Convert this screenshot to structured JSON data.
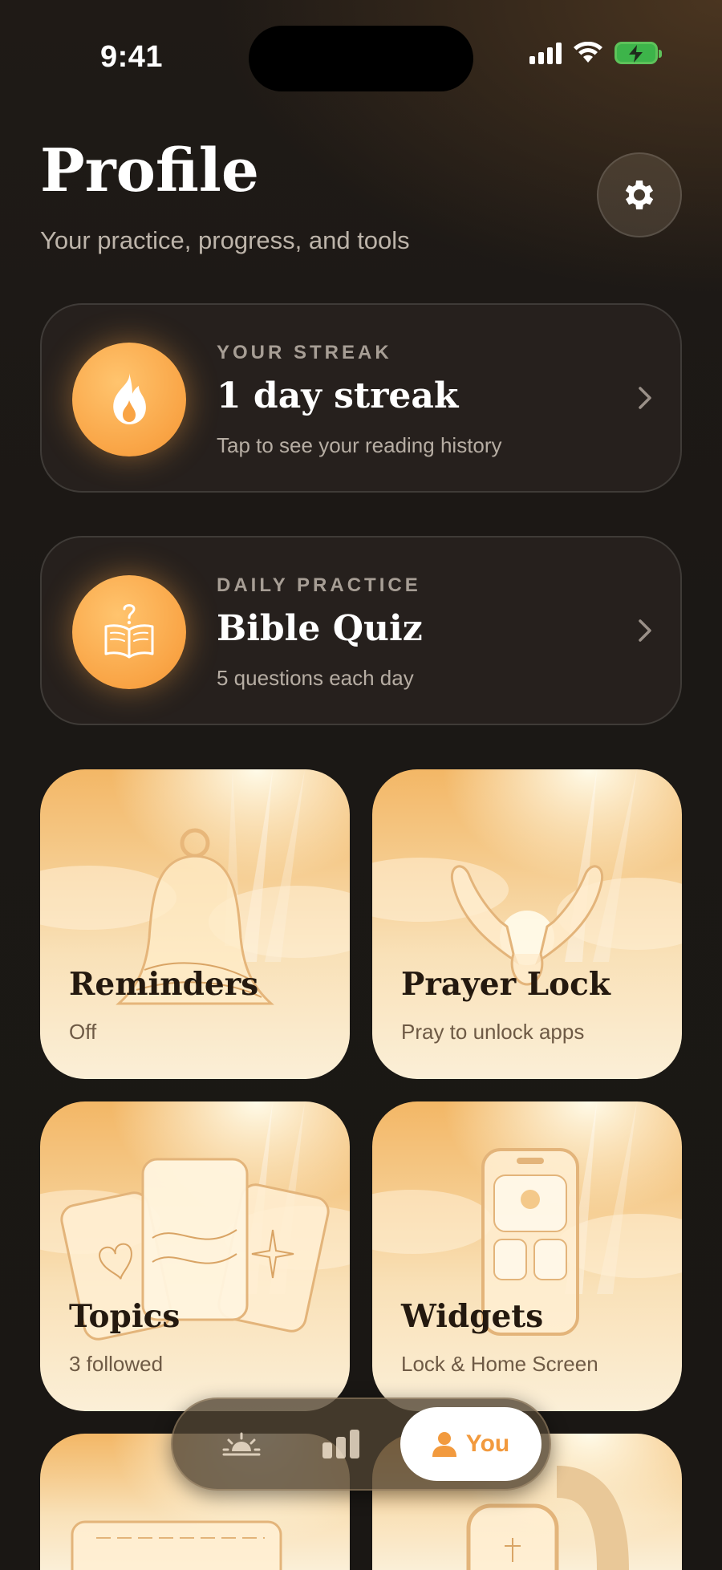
{
  "status_bar": {
    "time": "9:41"
  },
  "header": {
    "title": "Profile",
    "subtitle": "Your practice, progress, and tools"
  },
  "streak_card": {
    "eyebrow": "YOUR STREAK",
    "title": "1 day streak",
    "subtitle": "Tap to see your reading history"
  },
  "quiz_card": {
    "eyebrow": "DAILY PRACTICE",
    "title": "Bible Quiz",
    "subtitle": "5 questions each day"
  },
  "tiles": [
    {
      "title": "Reminders",
      "subtitle": "Off"
    },
    {
      "title": "Prayer Lock",
      "subtitle": "Pray to unlock apps"
    },
    {
      "title": "Topics",
      "subtitle": "3 followed"
    },
    {
      "title": "Widgets",
      "subtitle": "Lock & Home Screen"
    }
  ],
  "tabbar": {
    "active_label": "You"
  },
  "colors": {
    "accent": "#f9a445",
    "background": "#1b1815",
    "tile_text": "#24190f"
  },
  "icons": [
    "gear-icon",
    "flame-icon",
    "book-question-icon",
    "chevron-right-icon",
    "sunrise-icon",
    "bar-chart-icon",
    "person-icon"
  ]
}
